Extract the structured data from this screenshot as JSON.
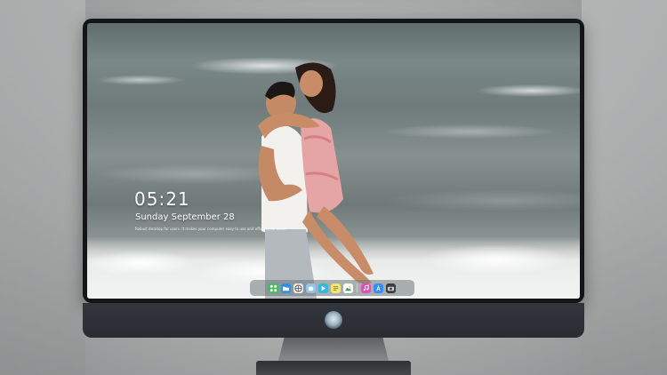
{
  "lock_screen": {
    "time": "05:21",
    "date": "Sunday September 28",
    "hint": "Robust desktop for users. It makes your computer easy to use and efficient for work."
  },
  "dock": {
    "icons": [
      "launcher-icon",
      "file-manager-icon",
      "browser-icon",
      "store-icon",
      "video-icon",
      "notes-icon",
      "photos-icon",
      "music-icon",
      "app-store-icon",
      "camera-icon"
    ]
  },
  "colors": {
    "frame": "#141516",
    "chin": "#2a2c32",
    "stand": "#7b7d81",
    "dock_background": "#6e7676"
  }
}
